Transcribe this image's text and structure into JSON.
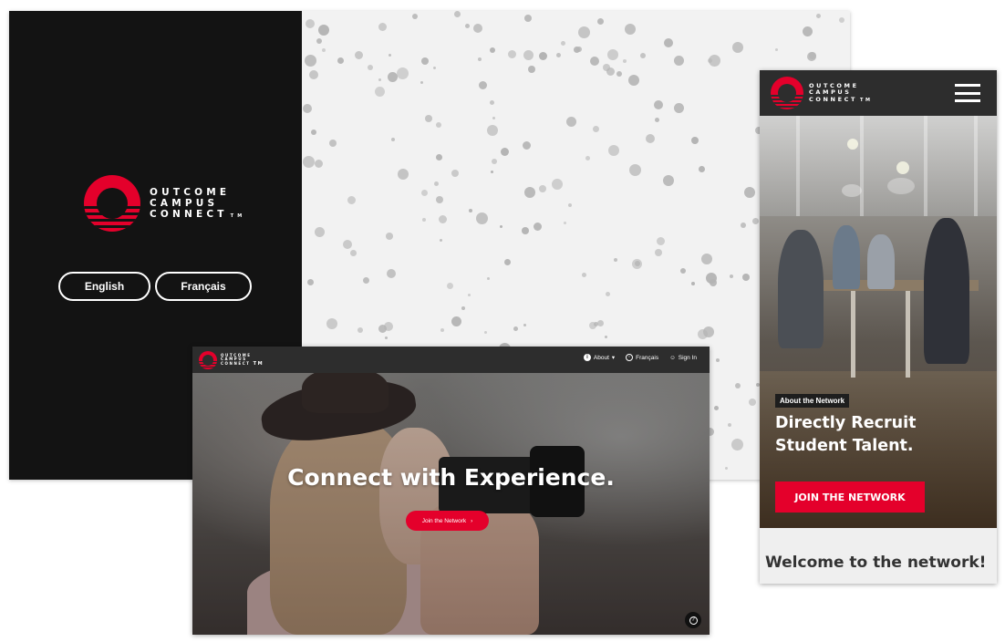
{
  "brand": {
    "line1": "OUTCOME",
    "line2": "CAMPUS",
    "line3": "CONNECT",
    "trademark": "TM",
    "accent_color": "#e4002b",
    "logo_icon": "outcome-o-logo-icon"
  },
  "splash": {
    "english_label": "English",
    "french_label": "Français"
  },
  "desktop": {
    "nav": {
      "about_label": "About",
      "french_label": "Français",
      "signin_label": "Sign In",
      "about_icon": "info-icon",
      "language_icon": "globe-icon",
      "signin_icon": "user-icon"
    },
    "hero": {
      "headline": "Connect with Experience.",
      "cta_label": "Join the Network"
    },
    "help_icon": "help-icon"
  },
  "mobile": {
    "menu_icon": "hamburger-icon",
    "hero": {
      "badge": "About the Network",
      "headline": "Directly Recruit Student Talent.",
      "cta_label": "JOIN THE NETWORK"
    },
    "welcome": "Welcome to the network!"
  }
}
